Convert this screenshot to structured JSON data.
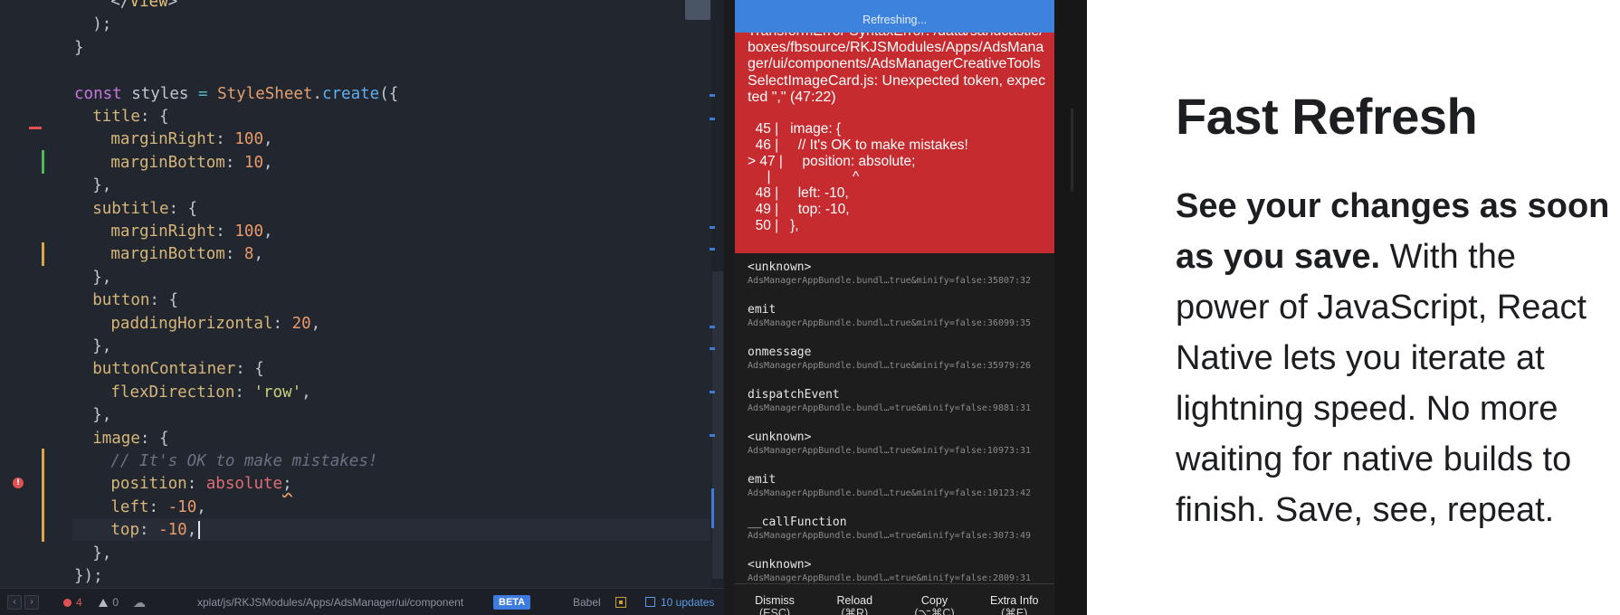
{
  "editor": {
    "lines": [
      {
        "ind": 3,
        "toks": [
          [
            "tok-punct",
            "</"
          ],
          [
            "tok-tag",
            "View"
          ],
          [
            "tok-punct",
            ">"
          ]
        ]
      },
      {
        "ind": 2,
        "toks": [
          [
            "tok-punct",
            ");"
          ]
        ]
      },
      {
        "ind": 1,
        "toks": [
          [
            "tok-punct",
            "}"
          ]
        ]
      },
      {
        "ind": 0,
        "toks": []
      },
      {
        "ind": 1,
        "toks": [
          [
            "tok-kw",
            "const "
          ],
          [
            "tok-var",
            "styles "
          ],
          [
            "tok-op",
            "= "
          ],
          [
            "tok-cls",
            "StyleSheet"
          ],
          [
            "tok-punct",
            "."
          ],
          [
            "tok-fn",
            "create"
          ],
          [
            "tok-punct",
            "({"
          ]
        ]
      },
      {
        "ind": 2,
        "toks": [
          [
            "tok-prop",
            "title"
          ],
          [
            "tok-punct",
            ": {"
          ]
        ]
      },
      {
        "ind": 3,
        "toks": [
          [
            "tok-prop",
            "marginRight"
          ],
          [
            "tok-punct",
            ": "
          ],
          [
            "tok-num",
            "100"
          ],
          [
            "tok-punct",
            ","
          ]
        ]
      },
      {
        "ind": 3,
        "toks": [
          [
            "tok-prop",
            "marginBottom"
          ],
          [
            "tok-punct",
            ": "
          ],
          [
            "tok-num",
            "10"
          ],
          [
            "tok-punct",
            ","
          ]
        ]
      },
      {
        "ind": 2,
        "toks": [
          [
            "tok-punct",
            "},"
          ]
        ]
      },
      {
        "ind": 2,
        "toks": [
          [
            "tok-prop",
            "subtitle"
          ],
          [
            "tok-punct",
            ": {"
          ]
        ]
      },
      {
        "ind": 3,
        "toks": [
          [
            "tok-prop",
            "marginRight"
          ],
          [
            "tok-punct",
            ": "
          ],
          [
            "tok-num",
            "100"
          ],
          [
            "tok-punct",
            ","
          ]
        ]
      },
      {
        "ind": 3,
        "toks": [
          [
            "tok-prop",
            "marginBottom"
          ],
          [
            "tok-punct",
            ": "
          ],
          [
            "tok-num",
            "8"
          ],
          [
            "tok-punct",
            ","
          ]
        ]
      },
      {
        "ind": 2,
        "toks": [
          [
            "tok-punct",
            "},"
          ]
        ]
      },
      {
        "ind": 2,
        "toks": [
          [
            "tok-prop",
            "button"
          ],
          [
            "tok-punct",
            ": {"
          ]
        ]
      },
      {
        "ind": 3,
        "toks": [
          [
            "tok-prop",
            "paddingHorizontal"
          ],
          [
            "tok-punct",
            ": "
          ],
          [
            "tok-num",
            "20"
          ],
          [
            "tok-punct",
            ","
          ]
        ]
      },
      {
        "ind": 2,
        "toks": [
          [
            "tok-punct",
            "},"
          ]
        ]
      },
      {
        "ind": 2,
        "toks": [
          [
            "tok-prop",
            "buttonContainer"
          ],
          [
            "tok-punct",
            ": {"
          ]
        ]
      },
      {
        "ind": 3,
        "toks": [
          [
            "tok-prop",
            "flexDirection"
          ],
          [
            "tok-punct",
            ": "
          ],
          [
            "tok-str",
            "'row'"
          ],
          [
            "tok-punct",
            ","
          ]
        ]
      },
      {
        "ind": 2,
        "toks": [
          [
            "tok-punct",
            "},"
          ]
        ]
      },
      {
        "ind": 2,
        "toks": [
          [
            "tok-prop",
            "image"
          ],
          [
            "tok-punct",
            ": {"
          ]
        ]
      },
      {
        "ind": 3,
        "toks": [
          [
            "tok-cmt",
            "// It's OK to make mistakes!"
          ]
        ]
      },
      {
        "ind": 3,
        "toks": [
          [
            "tok-prop",
            "position"
          ],
          [
            "tok-punct",
            ": "
          ],
          [
            "tok-err",
            "absolute"
          ],
          [
            "tok-punct squiggle",
            ";"
          ]
        ]
      },
      {
        "ind": 3,
        "toks": [
          [
            "tok-prop",
            "left"
          ],
          [
            "tok-punct",
            ": "
          ],
          [
            "tok-num",
            "-10"
          ],
          [
            "tok-punct",
            ","
          ]
        ]
      },
      {
        "ind": 3,
        "toks": [
          [
            "tok-prop",
            "top"
          ],
          [
            "tok-punct",
            ": "
          ],
          [
            "tok-num",
            "-10"
          ],
          [
            "tok-punct",
            ","
          ]
        ],
        "cursor": true
      },
      {
        "ind": 2,
        "toks": [
          [
            "tok-punct",
            "},"
          ]
        ]
      },
      {
        "ind": 1,
        "toks": [
          [
            "tok-punct",
            "});"
          ]
        ]
      }
    ]
  },
  "statusbar": {
    "errors": "4",
    "warnings": "0",
    "file_path": "xplat/js/RKJSModules/Apps/AdsManager/ui/component",
    "beta_label": "BETA",
    "babel_label": "Babel",
    "updates_label": "10 updates"
  },
  "phone": {
    "refresh_label": "Refreshing...",
    "error_message": "TransformError SyntaxError: /data/sandcastle/boxes/fbsource/RKJSModules/Apps/AdsManager/ui/components/AdsManagerCreativeToolsSelectImageCard.js: Unexpected token, expected \",\" (47:22)",
    "code_snippet": "  45 |   image: {\n  46 |     // It's OK to make mistakes!\n> 47 |     position: absolute;\n     |                     ^\n  48 |     left: -10,\n  49 |     top: -10,\n  50 |   },",
    "stack_frames": [
      {
        "fn": "<unknown>",
        "loc": "AdsManagerAppBundle.bundl…true&minify=false:35807:32"
      },
      {
        "fn": "emit",
        "loc": "AdsManagerAppBundle.bundl…true&minify=false:36099:35"
      },
      {
        "fn": "onmessage",
        "loc": "AdsManagerAppBundle.bundl…true&minify=false:35979:26"
      },
      {
        "fn": "dispatchEvent",
        "loc": "AdsManagerAppBundle.bundl…=true&minify=false:9881:31"
      },
      {
        "fn": "<unknown>",
        "loc": "AdsManagerAppBundle.bundl…true&minify=false:10973:31"
      },
      {
        "fn": "emit",
        "loc": "AdsManagerAppBundle.bundl…true&minify=false:10123:42"
      },
      {
        "fn": "__callFunction",
        "loc": "AdsManagerAppBundle.bundl…=true&minify=false:3073:49"
      },
      {
        "fn": "<unknown>",
        "loc": "AdsManagerAppBundle.bundl…=true&minify=false:2809:31"
      }
    ],
    "actions": [
      {
        "label": "Dismiss",
        "shortcut": "(ESC)"
      },
      {
        "label": "Reload",
        "shortcut": "(⌘R)"
      },
      {
        "label": "Copy",
        "shortcut": "(⌥⌘C)"
      },
      {
        "label": "Extra Info",
        "shortcut": "(⌘E)"
      }
    ]
  },
  "panel": {
    "title": "Fast Refresh",
    "lead_bold": "See your changes as soon as you save.",
    "body": " With the power of JavaScript, React Native lets you iterate at lightning speed. No more waiting for native builds to finish. Save, see, repeat."
  }
}
